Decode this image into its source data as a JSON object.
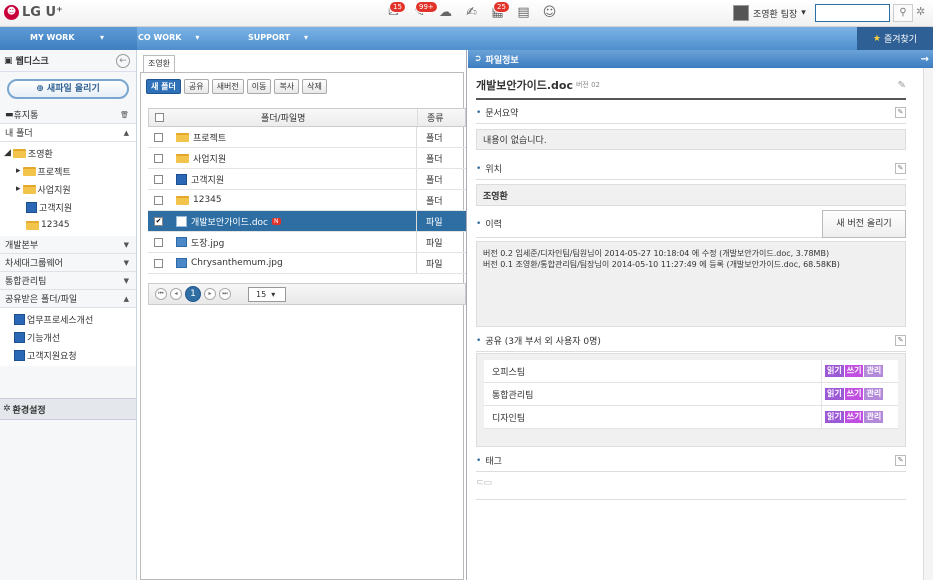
{
  "brand": {
    "logo_text": "LG U⁺"
  },
  "top_icons": [
    {
      "name": "mail-icon",
      "badge": "15"
    },
    {
      "name": "notify-icon",
      "badge": "99+"
    },
    {
      "name": "chat-icon",
      "badge": ""
    },
    {
      "name": "memo-icon",
      "badge": ""
    },
    {
      "name": "calendar-icon",
      "badge": "25"
    },
    {
      "name": "board-icon",
      "badge": ""
    },
    {
      "name": "people-icon",
      "badge": ""
    }
  ],
  "user": {
    "name": "조영환 팀장"
  },
  "menu": {
    "my_work": "MY WORK",
    "co_work": "CO WORK",
    "support": "SUPPORT",
    "favorites": "즐겨찾기"
  },
  "sidebar": {
    "title": "웹디스크",
    "upload": "새파일 올리기",
    "trash": "휴지통",
    "my_folder": "내 폴더",
    "tree": [
      {
        "label": "조영환",
        "level": 0
      },
      {
        "label": "프로젝트",
        "level": 1
      },
      {
        "label": "사업지원",
        "level": 1
      },
      {
        "label": "고객지원",
        "level": 1
      },
      {
        "label": "12345",
        "level": 1
      }
    ],
    "groups": [
      "개발본부",
      "차세대그룹웨어",
      "통합관리팀"
    ],
    "shared": "공유받은 폴더/파일",
    "shared_items": [
      "업무프로세스개선",
      "기능개선",
      "고객지원요청"
    ],
    "settings": "환경설정"
  },
  "middle": {
    "tab": "조영환",
    "toolbar": [
      "새 폴더",
      "공유",
      "새버전",
      "이동",
      "복사",
      "삭제"
    ],
    "col_name": "폴더/파일명",
    "col_type": "종류",
    "rows": [
      {
        "name": "프로젝트",
        "type": "폴더",
        "icon": "folder",
        "selected": false
      },
      {
        "name": "사업지원",
        "type": "폴더",
        "icon": "folder",
        "selected": false
      },
      {
        "name": "고객지원",
        "type": "폴더",
        "icon": "shared-folder",
        "selected": false
      },
      {
        "name": "12345",
        "type": "폴더",
        "icon": "folder",
        "selected": false
      },
      {
        "name": "개발보안가이드.doc",
        "type": "파일",
        "icon": "doc",
        "selected": true,
        "badge": "N"
      },
      {
        "name": "도장.jpg",
        "type": "파일",
        "icon": "image",
        "selected": false
      },
      {
        "name": "Chrysanthemum.jpg",
        "type": "파일",
        "icon": "image",
        "selected": false
      }
    ],
    "page": "1",
    "page_size": "15"
  },
  "info": {
    "header": "파일정보",
    "file_name": "개발보안가이드.doc",
    "version": "버전 02",
    "summary_label": "문서요약",
    "summary_text": "내용이 없습니다.",
    "location_label": "위치",
    "location_text": "조영환",
    "history_label": "이력",
    "new_version_btn": "새 버전 올리기",
    "history": [
      "버전 0.2 임세준/디자인팀/팀원님이 2014-05-27 10:18:04 에 수정 (개발보안가이드.doc, 3.78MB)",
      "버전 0.1 조영환/통합관리팀/팀장님이 2014-05-10 11:27:49 에 등록 (개발보안가이드.doc, 68.58KB)"
    ],
    "share_label": "공유 (3개 부서 외 사용자 0명)",
    "share_rows": [
      "오피스팀",
      "통합관리팀",
      "디자인팀"
    ],
    "perm": {
      "read": "읽기",
      "write": "쓰기",
      "manage": "관리"
    },
    "tag_label": "태그"
  },
  "colors": {
    "accent": "#2e6ea3",
    "read": "#9b59d6",
    "write": "#c04ee0",
    "manage": "#b38ad9"
  }
}
